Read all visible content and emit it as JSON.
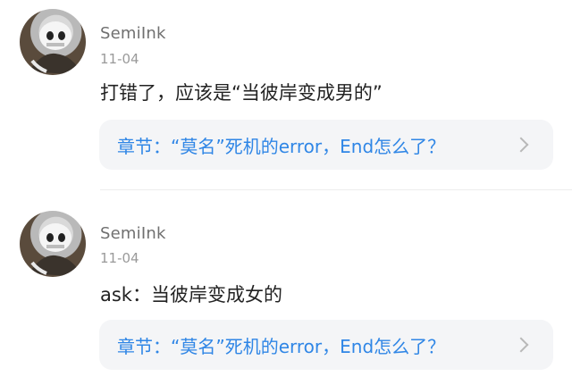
{
  "comments": [
    {
      "username": "SemiInk",
      "date": "11-04",
      "text": "打错了，应该是“当彼岸变成男的”",
      "chapter_link": "章节：“莫名”死机的error，End怎么了？"
    },
    {
      "username": "SemiInk",
      "date": "11-04",
      "text": "ask：当彼岸变成女的",
      "chapter_link": "章节：“莫名”死机的error，End怎么了？"
    }
  ],
  "icons": {
    "chapter_arrow": "chevron-right-icon",
    "avatar": "user-avatar"
  },
  "colors": {
    "link": "#2f86e6",
    "chapter_bg": "#f4f5f7",
    "username": "#707070",
    "date": "#9a9a9a"
  }
}
